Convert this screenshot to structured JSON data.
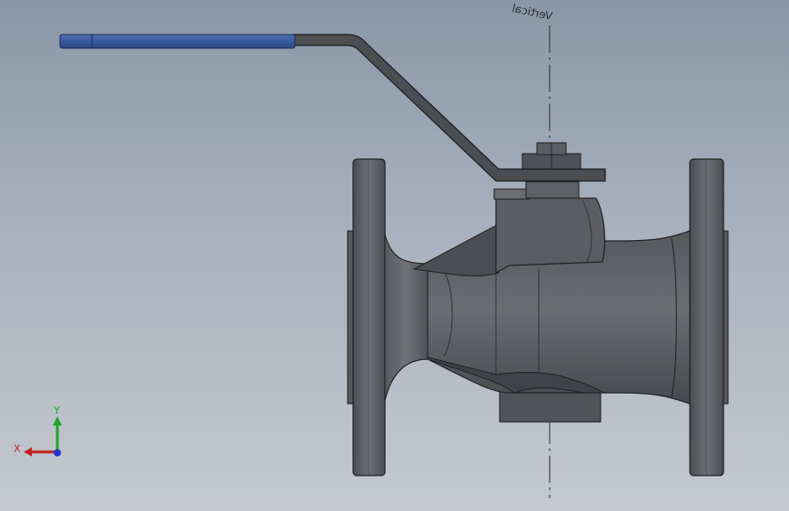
{
  "viewport": {
    "plane_label": "Vertical",
    "triad": {
      "x_label": "X",
      "y_label": "Y"
    }
  },
  "model": {
    "part": "ball-valve",
    "handle_grip_color": "#3a5aa0",
    "body_color": "#5e6165",
    "edge_color": "#202225"
  }
}
